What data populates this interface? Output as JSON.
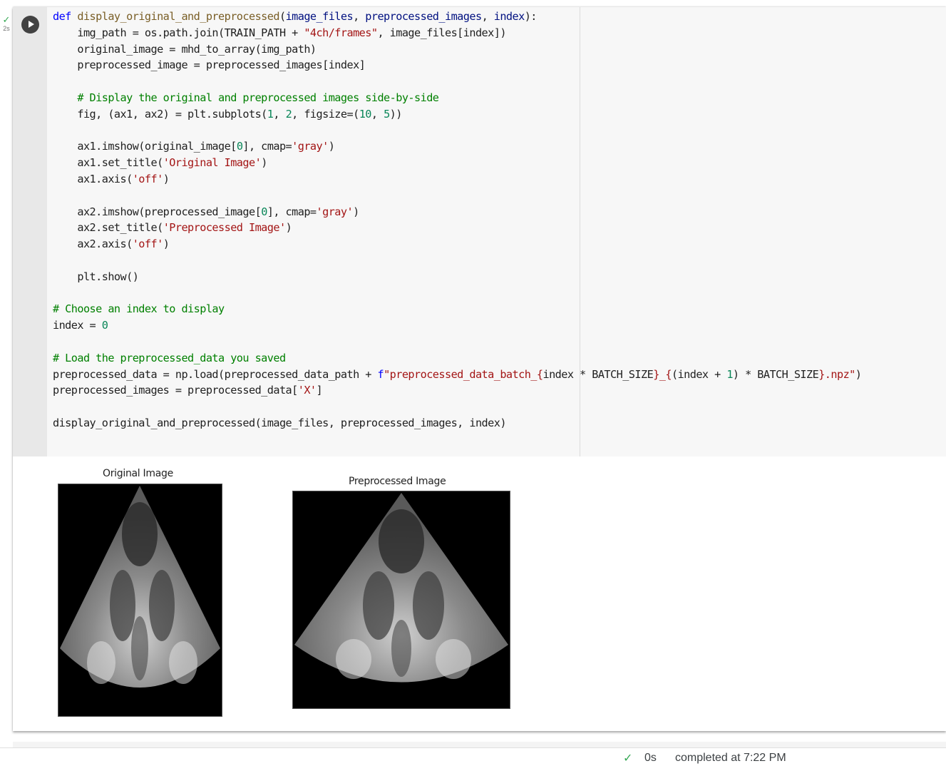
{
  "cell": {
    "exec_status_icon": "check-icon",
    "exec_check": "✓",
    "exec_time": "2s",
    "run_button_icon": "play-icon",
    "code_lines": [
      [
        {
          "t": "def",
          "c": "kw"
        },
        {
          "t": " "
        },
        {
          "t": "display_original_and_preprocessed",
          "c": "fn"
        },
        {
          "t": "("
        },
        {
          "t": "image_files",
          "c": "pm"
        },
        {
          "t": ", "
        },
        {
          "t": "preprocessed_images",
          "c": "pm"
        },
        {
          "t": ", "
        },
        {
          "t": "index",
          "c": "pm"
        },
        {
          "t": "):"
        }
      ],
      [
        {
          "t": "    img_path = os.path.join(TRAIN_PATH + "
        },
        {
          "t": "\"4ch/frames\"",
          "c": "str"
        },
        {
          "t": ", image_files[index])"
        }
      ],
      [
        {
          "t": "    original_image = mhd_to_array(img_path)"
        }
      ],
      [
        {
          "t": "    preprocessed_image = preprocessed_images[index]"
        }
      ],
      [
        {
          "t": ""
        }
      ],
      [
        {
          "t": "    "
        },
        {
          "t": "# Display the original and preprocessed images side-by-side",
          "c": "cm"
        }
      ],
      [
        {
          "t": "    fig, (ax1, ax2) = plt.subplots("
        },
        {
          "t": "1",
          "c": "num"
        },
        {
          "t": ", "
        },
        {
          "t": "2",
          "c": "num"
        },
        {
          "t": ", figsize=("
        },
        {
          "t": "10",
          "c": "num"
        },
        {
          "t": ", "
        },
        {
          "t": "5",
          "c": "num"
        },
        {
          "t": "))"
        }
      ],
      [
        {
          "t": ""
        }
      ],
      [
        {
          "t": "    ax1.imshow(original_image["
        },
        {
          "t": "0",
          "c": "num"
        },
        {
          "t": "], cmap="
        },
        {
          "t": "'gray'",
          "c": "str"
        },
        {
          "t": ")"
        }
      ],
      [
        {
          "t": "    ax1.set_title("
        },
        {
          "t": "'Original Image'",
          "c": "str"
        },
        {
          "t": ")"
        }
      ],
      [
        {
          "t": "    ax1.axis("
        },
        {
          "t": "'off'",
          "c": "str"
        },
        {
          "t": ")"
        }
      ],
      [
        {
          "t": ""
        }
      ],
      [
        {
          "t": "    ax2.imshow(preprocessed_image["
        },
        {
          "t": "0",
          "c": "num"
        },
        {
          "t": "], cmap="
        },
        {
          "t": "'gray'",
          "c": "str"
        },
        {
          "t": ")"
        }
      ],
      [
        {
          "t": "    ax2.set_title("
        },
        {
          "t": "'Preprocessed Image'",
          "c": "str"
        },
        {
          "t": ")"
        }
      ],
      [
        {
          "t": "    ax2.axis("
        },
        {
          "t": "'off'",
          "c": "str"
        },
        {
          "t": ")"
        }
      ],
      [
        {
          "t": ""
        }
      ],
      [
        {
          "t": "    plt.show()"
        }
      ],
      [
        {
          "t": ""
        }
      ],
      [
        {
          "t": "# Choose an index to display",
          "c": "cm"
        }
      ],
      [
        {
          "t": "index = "
        },
        {
          "t": "0",
          "c": "num"
        }
      ],
      [
        {
          "t": ""
        }
      ],
      [
        {
          "t": "# Load the preprocessed_data you saved",
          "c": "cm"
        }
      ],
      [
        {
          "t": "preprocessed_data = np.load(preprocessed_data_path + "
        },
        {
          "t": "f",
          "c": "kw"
        },
        {
          "t": "\"preprocessed_data_batch_{",
          "c": "str"
        },
        {
          "t": "index * BATCH_SIZE"
        },
        {
          "t": "}_{",
          "c": "str"
        },
        {
          "t": "(index + "
        },
        {
          "t": "1",
          "c": "num"
        },
        {
          "t": ") * BATCH_SIZE"
        },
        {
          "t": "}.npz\"",
          "c": "str"
        },
        {
          "t": ")"
        }
      ],
      [
        {
          "t": "preprocessed_images = preprocessed_data["
        },
        {
          "t": "'X'",
          "c": "str"
        },
        {
          "t": "]"
        }
      ],
      [
        {
          "t": ""
        }
      ],
      [
        {
          "t": "display_original_and_preprocessed(image_files, preprocessed_images, index)"
        }
      ]
    ]
  },
  "output": {
    "figures": [
      {
        "title": "Original Image",
        "image": "echocardiogram-4-chamber-original"
      },
      {
        "title": "Preprocessed Image",
        "image": "echocardiogram-4-chamber-preprocessed"
      }
    ]
  },
  "status_bar": {
    "check": "✓",
    "duration": "0s",
    "text": "completed at 7:22 PM"
  },
  "colors": {
    "keyword": "#0000ff",
    "function": "#795e26",
    "param": "#001080",
    "string": "#a31515",
    "number": "#098658",
    "comment": "#008000",
    "success": "#34a853"
  }
}
